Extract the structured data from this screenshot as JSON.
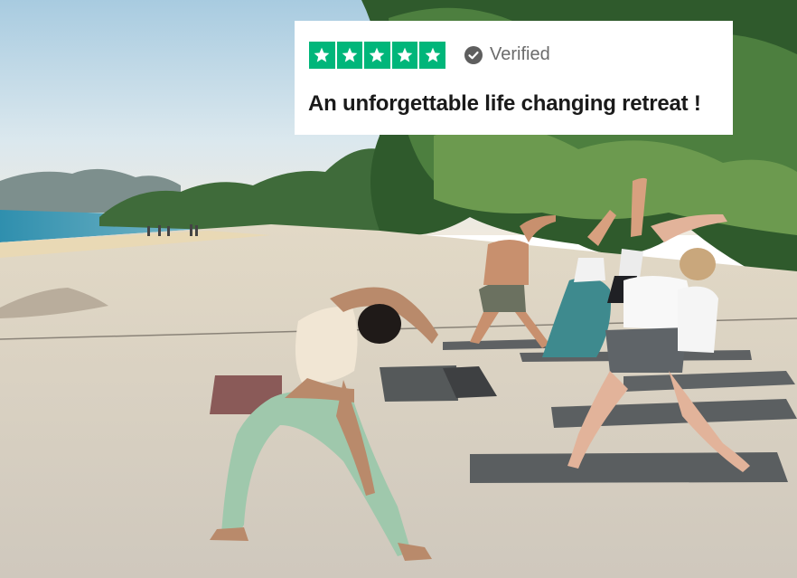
{
  "review": {
    "rating": 5,
    "rating_max": 5,
    "star_color": "#00b67a",
    "verified_label": "Verified",
    "verified_icon": "check-circle-icon",
    "title": "An unforgettable life changing retreat !"
  },
  "scene": {
    "sky_color": "#cfe3ee",
    "sand_color": "#d9d2c6",
    "sea_color": "#3f9fb8"
  }
}
